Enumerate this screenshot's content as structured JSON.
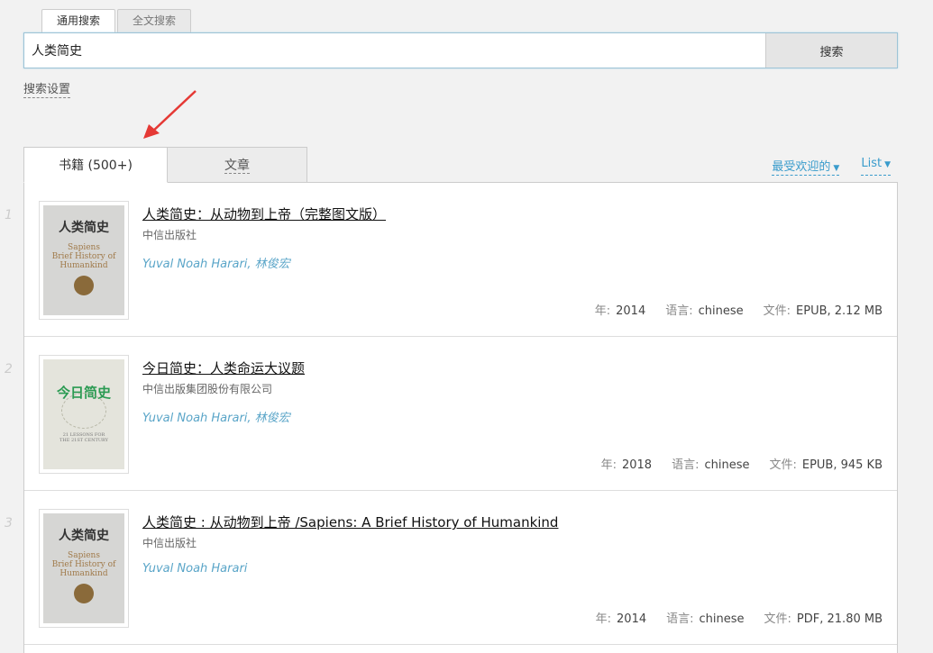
{
  "search": {
    "tabs": [
      "通用搜索",
      "全文搜索"
    ],
    "query": "人类简史",
    "button_label": "搜索",
    "settings_label": "搜索设置"
  },
  "results_tabs": {
    "books_label": "书籍 (500+)",
    "articles_label": "文章"
  },
  "sort": {
    "popularity_label": "最受欢迎的",
    "view_label": "List"
  },
  "meta_labels": {
    "year": "年:",
    "language": "语言:",
    "file": "文件:"
  },
  "results": [
    {
      "num": "1",
      "title": "人类简史：从动物到上帝（完整图文版）",
      "publisher": "中信出版社",
      "authors": "Yuval Noah Harari, 林俊宏",
      "year": "2014",
      "language": "chinese",
      "file": "EPUB, 2.12 MB"
    },
    {
      "num": "2",
      "title": "今日简史：人类命运大议题",
      "publisher": "中信出版集团股份有限公司",
      "authors": "Yuval Noah Harari, 林俊宏",
      "year": "2018",
      "language": "chinese",
      "file": "EPUB, 945 KB"
    },
    {
      "num": "3",
      "title": "人类简史 : 从动物到上帝 /Sapiens: A Brief History of Humankind",
      "publisher": "中信出版社",
      "authors": "Yuval Noah Harari",
      "year": "2014",
      "language": "chinese",
      "file": "PDF, 21.80 MB"
    }
  ],
  "covers": [
    {
      "main": "人类简史",
      "en": "Sapiens\nBrief History of\nHumankind"
    },
    {
      "main": "今日简史",
      "en": "21 LESSONS FOR\nTHE 21ST CENTURY"
    },
    {
      "main": "人类简史",
      "en": "Sapiens\nBrief History of\nHumankind"
    }
  ],
  "colors": {
    "accent_link": "#3a9ccc",
    "author_text": "#5aa5c8",
    "arrow": "#e53935"
  }
}
